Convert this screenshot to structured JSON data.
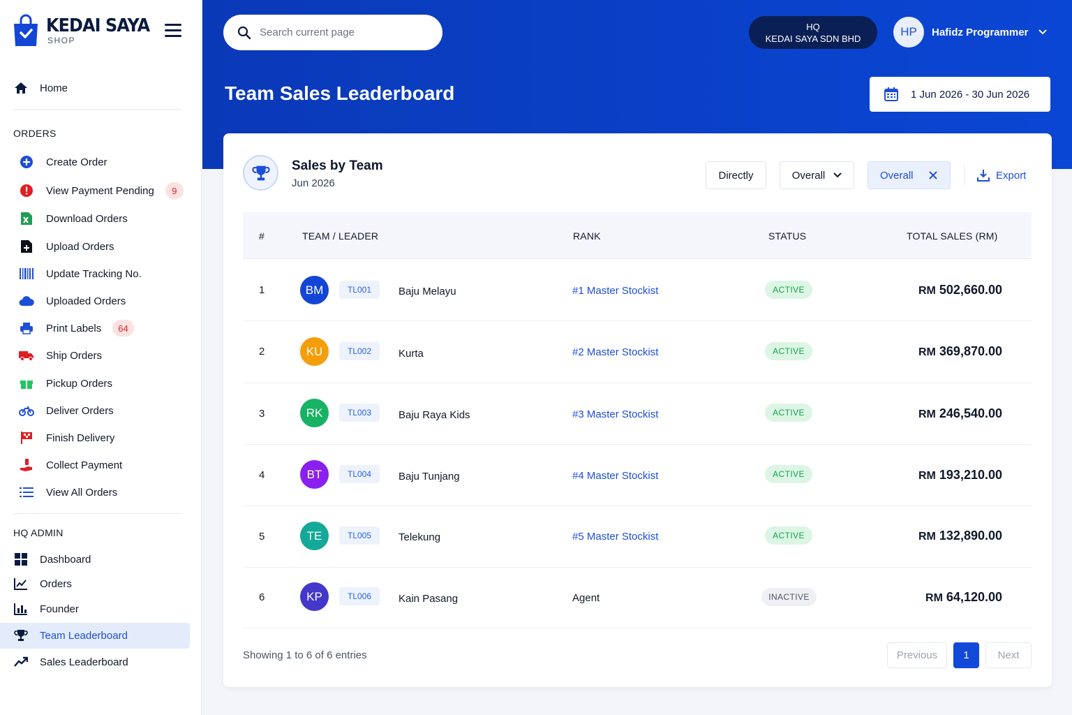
{
  "brand": {
    "name": "KEDAI SAYA",
    "sub": "SHOP"
  },
  "nav": {
    "home": "Home",
    "orders_title": "ORDERS",
    "orders": [
      {
        "label": "Create Order",
        "icon": "plus-circle-icon"
      },
      {
        "label": "View Payment Pending",
        "icon": "alert-circle-icon",
        "badge": "9"
      },
      {
        "label": "Download Orders",
        "icon": "excel-file-icon"
      },
      {
        "label": "Upload Orders",
        "icon": "file-upload-icon"
      },
      {
        "label": "Update Tracking No.",
        "icon": "barcode-icon"
      },
      {
        "label": "Uploaded Orders",
        "icon": "cloud-icon"
      },
      {
        "label": "Print Labels",
        "icon": "printer-icon",
        "badge": "64"
      },
      {
        "label": "Ship Orders",
        "icon": "truck-icon"
      },
      {
        "label": "Pickup Orders",
        "icon": "gift-icon"
      },
      {
        "label": "Deliver Orders",
        "icon": "motorcycle-icon"
      },
      {
        "label": "Finish Delivery",
        "icon": "checkered-flag-icon"
      },
      {
        "label": "Collect Payment",
        "icon": "hand-money-icon"
      },
      {
        "label": "View All Orders",
        "icon": "list-icon"
      }
    ],
    "admin_title": "HQ ADMIN",
    "admin": [
      {
        "label": "Dashboard",
        "icon": "grid-icon"
      },
      {
        "label": "Orders",
        "icon": "line-chart-icon"
      },
      {
        "label": "Founder",
        "icon": "bar-chart-icon"
      },
      {
        "label": "Team Leaderboard",
        "icon": "trophy-icon",
        "active": true
      },
      {
        "label": "Sales Leaderboard",
        "icon": "trend-up-icon"
      }
    ]
  },
  "header": {
    "search_placeholder": "Search current page",
    "hq_line1": "HQ",
    "hq_line2": "KEDAI SAYA SDN BHD",
    "user_initials": "HP",
    "user_name": "Hafidz Programmer",
    "page_title": "Team Sales Leaderboard",
    "date_range": "1 Jun 2026 - 30 Jun 2026"
  },
  "card": {
    "title": "Sales by Team",
    "subtitle": "Jun 2026",
    "btn_directly": "Directly",
    "btn_overall": "Overall",
    "chip_overall": "Overall",
    "export": "Export"
  },
  "table": {
    "headers": [
      "#",
      "TEAM / LEADER",
      "RANK",
      "STATUS",
      "TOTAL SALES (RM)"
    ],
    "rows": [
      {
        "num": "1",
        "initials": "BM",
        "color": "#1446d6",
        "code": "TL001",
        "name": "Baju Melayu",
        "rank": "#1 Master Stockist",
        "status": "ACTIVE",
        "currency": "RM",
        "total": "502,660.00"
      },
      {
        "num": "2",
        "initials": "KU",
        "color": "#f59e0b",
        "code": "TL002",
        "name": "Kurta",
        "rank": "#2 Master Stockist",
        "status": "ACTIVE",
        "currency": "RM",
        "total": "369,870.00"
      },
      {
        "num": "3",
        "initials": "RK",
        "color": "#16b364",
        "code": "TL003",
        "name": "Baju Raya Kids",
        "rank": "#3 Master Stockist",
        "status": "ACTIVE",
        "currency": "RM",
        "total": "246,540.00"
      },
      {
        "num": "4",
        "initials": "BT",
        "color": "#8b1ff0",
        "code": "TL004",
        "name": "Baju Tunjang",
        "rank": "#4 Master Stockist",
        "status": "ACTIVE",
        "currency": "RM",
        "total": "193,210.00"
      },
      {
        "num": "5",
        "initials": "TE",
        "color": "#14a898",
        "code": "TL005",
        "name": "Telekung",
        "rank": "#5 Master Stockist",
        "status": "ACTIVE",
        "currency": "RM",
        "total": "132,890.00"
      },
      {
        "num": "6",
        "initials": "KP",
        "color": "#4338ca",
        "code": "TL006",
        "name": "Kain Pasang",
        "rank": "Agent",
        "status": "INACTIVE",
        "currency": "RM",
        "total": "64,120.00"
      }
    ]
  },
  "footer": {
    "info": "Showing 1 to 6 of 6 entries",
    "prev": "Previous",
    "page": "1",
    "next": "Next"
  }
}
